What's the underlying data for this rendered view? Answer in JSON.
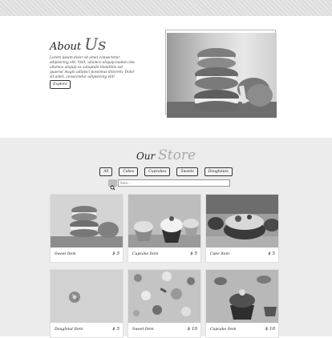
{
  "about": {
    "title_small": "About",
    "title_big": "Us",
    "paragraph": "Lorem ipsum dolor sit amet consectetur adipisicing elit. Velit, ullamco aliquip laudan iste ullamco aliquip ex voluptate blanditiis est quaerat magni adipisci possimus dolorem. Dolor sit amet, consectetur adipisicing elit!",
    "button_label": "Explore"
  },
  "store": {
    "title_small": "Our",
    "title_big": "Store",
    "filters": [
      "All",
      "Cakes",
      "Cupcakes",
      "Sweets",
      "Doughnuts"
    ],
    "search_placeholder": "item..."
  },
  "items": [
    {
      "name": "Sweet Item",
      "price": "$ 5"
    },
    {
      "name": "Cupcake Item",
      "price": "$ 5"
    },
    {
      "name": "Cake Item",
      "price": "$ 5"
    },
    {
      "name": "Doughnut Item",
      "price": "$ 5"
    },
    {
      "name": "Sweet Item",
      "price": "$ 10"
    },
    {
      "name": "Cupcake Item",
      "price": "$ 10"
    }
  ]
}
